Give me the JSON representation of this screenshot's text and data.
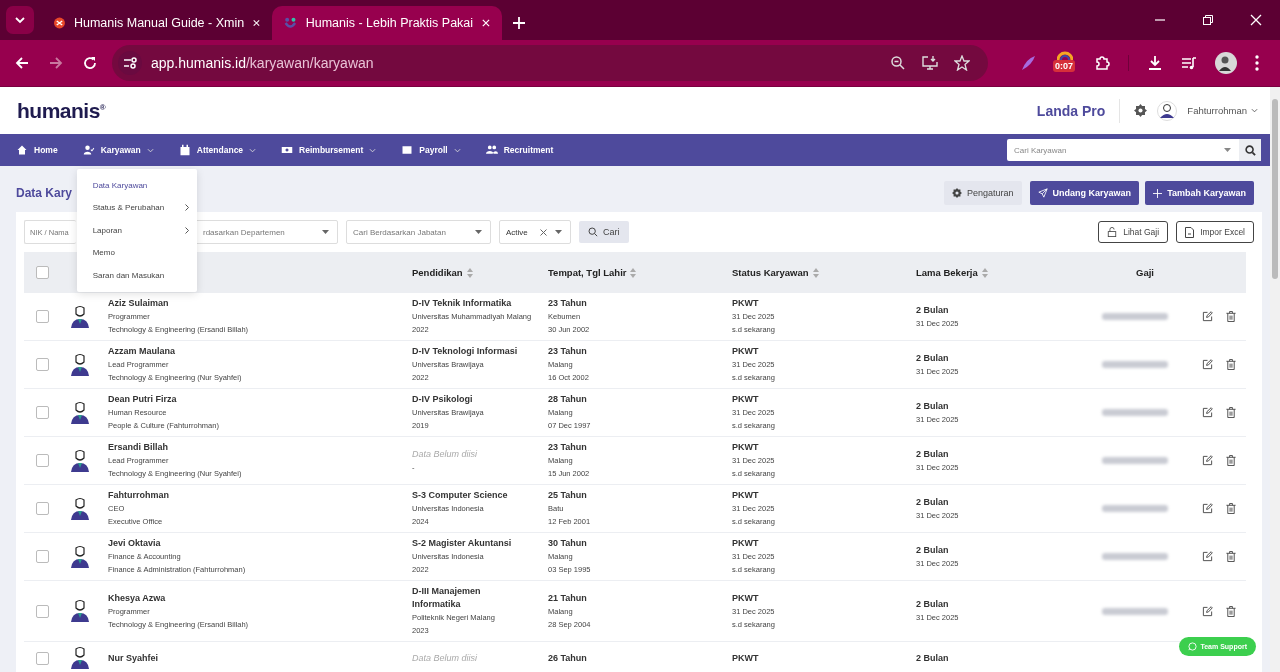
{
  "browser": {
    "tabs": [
      {
        "title": "Humanis Manual Guide - Xmin",
        "selected": false
      },
      {
        "title": "Humanis - Lebih Praktis Pakai",
        "selected": true
      }
    ],
    "url_host": "app.humanis.id",
    "url_path": "/karyawan/karyawan",
    "timer_badge": "0:07"
  },
  "header": {
    "logo": "humanis$^{®}$",
    "company": "Landa Pro",
    "user": "Fahturrohman"
  },
  "nav": {
    "items": [
      {
        "label": "Home",
        "dropdown": false,
        "expanded": false
      },
      {
        "label": "Karyawan",
        "dropdown": true,
        "expanded": true
      },
      {
        "label": "Attendance",
        "dropdown": true,
        "expanded": false
      },
      {
        "label": "Reimbursement",
        "dropdown": true,
        "expanded": false
      },
      {
        "label": "Payroll",
        "dropdown": true,
        "expanded": false
      },
      {
        "label": "Recruitment",
        "dropdown": false,
        "expanded": false
      }
    ],
    "search_placeholder": "Cari Karyawan"
  },
  "menu": [
    {
      "label": "Data Karyawan",
      "selected": true,
      "submenu": false
    },
    {
      "label": "Status & Perubahan",
      "selected": false,
      "submenu": true
    },
    {
      "label": "Laporan",
      "selected": false,
      "submenu": true
    },
    {
      "label": "Memo",
      "selected": false,
      "submenu": false
    },
    {
      "label": "Saran dan Masukan",
      "selected": false,
      "submenu": false
    }
  ],
  "page_title": "Data Kary",
  "actions": [
    {
      "label": "Pengaturan",
      "kind": "secondary"
    },
    {
      "label": "Undang Karyawan",
      "kind": "primary"
    },
    {
      "label": "Tambah Karyawan",
      "kind": "primary"
    }
  ],
  "filters": [
    {
      "kind": "text",
      "placeholder": "NIK / Nama"
    },
    {
      "kind": "select",
      "placeholder": "rdasarkan Departemen"
    },
    {
      "kind": "select",
      "placeholder": "Cari Berdasarkan Jabatan"
    },
    {
      "kind": "clearable",
      "value": "Active"
    }
  ],
  "search_button": "Cari",
  "tools": [
    "Lihat Gaji",
    "Impor Excel"
  ],
  "table": {
    "select_all": {
      "checked": false
    },
    "columns": [
      {
        "label": "Pendidikan",
        "sortable": true
      },
      {
        "label": "Tempat, Tgl Lahir",
        "sortable": true
      },
      {
        "label": "Status Karyawan",
        "sortable": true
      },
      {
        "label": "Lama Bekerja",
        "sortable": true
      },
      {
        "label": "Gaji",
        "sortable": false
      }
    ],
    "rows": [
      {
        "checked": false,
        "name": "Aziz Sulaiman",
        "role": "Programmer",
        "department": "Technology & Engineering (Ersandi Billah)",
        "education": {
          "kind": "filled",
          "degree": "D-IV Teknik Informatika",
          "school": "Universitas Muhammadiyah Malang",
          "year": "2022"
        },
        "age": "23 Tahun",
        "city": "Kebumen",
        "birth": "30 Jun 2002",
        "status": "PKWT",
        "status_from": "31 Dec 2025",
        "status_to": "s.d sekarang",
        "tenure": "2 Bulan",
        "tenure_since": "31 Dec 2025"
      },
      {
        "checked": false,
        "name": "Azzam Maulana",
        "role": "Lead Programmer",
        "department": "Technology & Engineering (Nur Syahfei)",
        "education": {
          "kind": "filled",
          "degree": "D-IV Teknologi Informasi",
          "school": "Universitas Brawijaya",
          "year": "2022"
        },
        "age": "23 Tahun",
        "city": "Malang",
        "birth": "16 Oct 2002",
        "status": "PKWT",
        "status_from": "31 Dec 2025",
        "status_to": "s.d sekarang",
        "tenure": "2 Bulan",
        "tenure_since": "31 Dec 2025"
      },
      {
        "checked": false,
        "name": "Dean Putri Firza",
        "role": "Human Resource",
        "department": "People & Culture (Fahturrohman)",
        "education": {
          "kind": "filled",
          "degree": "D-IV Psikologi",
          "school": "Universitas Brawijaya",
          "year": "2019"
        },
        "age": "28 Tahun",
        "city": "Malang",
        "birth": "07 Dec 1997",
        "status": "PKWT",
        "status_from": "31 Dec 2025",
        "status_to": "s.d sekarang",
        "tenure": "2 Bulan",
        "tenure_since": "31 Dec 2025"
      },
      {
        "checked": false,
        "name": "Ersandi Billah",
        "role": "Lead Programmer",
        "department": "Technology & Engineering (Nur Syahfei)",
        "education": {
          "kind": "empty",
          "note": "Data Belum diisi",
          "detail": "-"
        },
        "age": "23 Tahun",
        "city": "Malang",
        "birth": "15 Jun 2002",
        "status": "PKWT",
        "status_from": "31 Dec 2025",
        "status_to": "s.d sekarang",
        "tenure": "2 Bulan",
        "tenure_since": "31 Dec 2025"
      },
      {
        "checked": false,
        "name": "Fahturrohman",
        "role": "CEO",
        "department": "Executive Office",
        "education": {
          "kind": "filled",
          "degree": "S-3 Computer Science",
          "school": "Universitas Indonesia",
          "year": "2024"
        },
        "age": "25 Tahun",
        "city": "Batu",
        "birth": "12 Feb 2001",
        "status": "PKWT",
        "status_from": "31 Dec 2025",
        "status_to": "s.d sekarang",
        "tenure": "2 Bulan",
        "tenure_since": "31 Dec 2025"
      },
      {
        "checked": false,
        "name": "Jevi Oktavia",
        "role": "Finance & Accounting",
        "department": "Finance & Administration (Fahturrohman)",
        "education": {
          "kind": "filled",
          "degree": "S-2 Magister Akuntansi",
          "school": "Universitas Indonesia",
          "year": "2022"
        },
        "age": "30 Tahun",
        "city": "Malang",
        "birth": "03 Sep 1995",
        "status": "PKWT",
        "status_from": "31 Dec 2025",
        "status_to": "s.d sekarang",
        "tenure": "2 Bulan",
        "tenure_since": "31 Dec 2025"
      },
      {
        "checked": false,
        "name": "Khesya Azwa",
        "role": "Programmer",
        "department": "Technology & Engineering (Ersandi Billah)",
        "education": {
          "kind": "filled",
          "degree": "D-III Manajemen Informatika",
          "school": "Politeknik Negeri Malang",
          "year": "2023"
        },
        "age": "21 Tahun",
        "city": "Malang",
        "birth": "28 Sep 2004",
        "status": "PKWT",
        "status_from": "31 Dec 2025",
        "status_to": "s.d sekarang",
        "tenure": "2 Bulan",
        "tenure_since": "31 Dec 2025"
      },
      {
        "checked": false,
        "name": "Nur Syahfei",
        "education": {
          "kind": "empty",
          "note": "Data Belum diisi"
        },
        "age": "26 Tahun",
        "status": "PKWT",
        "tenure": "2 Bulan"
      }
    ]
  },
  "support_button": "Team Support"
}
